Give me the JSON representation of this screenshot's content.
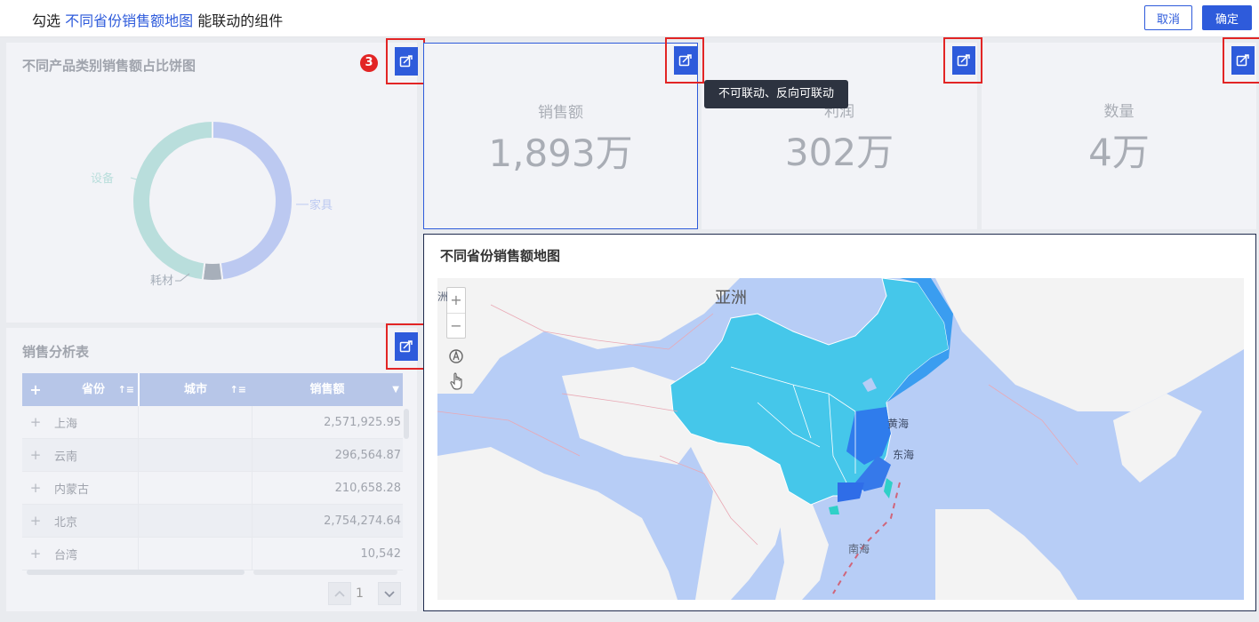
{
  "header": {
    "instruction_prefix": "勾选",
    "instruction_target": "不同省份销售额地图",
    "instruction_suffix": "能联动的组件",
    "cancel_label": "取消",
    "confirm_label": "确定"
  },
  "pie_panel": {
    "title": "不同产品类别销售额占比饼图",
    "badge": "3",
    "legend": {
      "shebei": "设备",
      "jiaju": "家具",
      "haocai": "耗材"
    }
  },
  "chart_data": {
    "type": "pie",
    "title": "不同产品类别销售额占比饼图",
    "categories": [
      "家具",
      "耗材",
      "设备"
    ],
    "values": [
      48,
      4,
      48
    ],
    "colors": [
      "#bcc9f1",
      "#a7afba",
      "#b9dedc"
    ]
  },
  "kpis": [
    {
      "label": "销售额",
      "value": "1,893万"
    },
    {
      "label": "利润",
      "value": "302万"
    },
    {
      "label": "数量",
      "value": "4万"
    }
  ],
  "tooltip": "不可联动、反向可联动",
  "table_panel": {
    "title": "销售分析表",
    "columns": {
      "plus": "+",
      "province": "省份",
      "city": "城市",
      "sales": "销售额"
    },
    "rows": [
      {
        "province": "上海",
        "sales": "2,571,925.95"
      },
      {
        "province": "云南",
        "sales": "296,564.87"
      },
      {
        "province": "内蒙古",
        "sales": "210,658.28"
      },
      {
        "province": "北京",
        "sales": "2,754,274.64"
      },
      {
        "province": "台湾",
        "sales": "10,542"
      }
    ],
    "page": "1"
  },
  "map_panel": {
    "title": "不同省份销售额地图",
    "labels": {
      "asia": "亚洲",
      "huanghai": "黄海",
      "donghai": "东海",
      "nanhai": "南海",
      "edge": "洲"
    },
    "zoom_in": "+",
    "zoom_out": "−"
  },
  "colors": {
    "accent": "#2e5bdb",
    "highlight_border": "#e22525"
  }
}
